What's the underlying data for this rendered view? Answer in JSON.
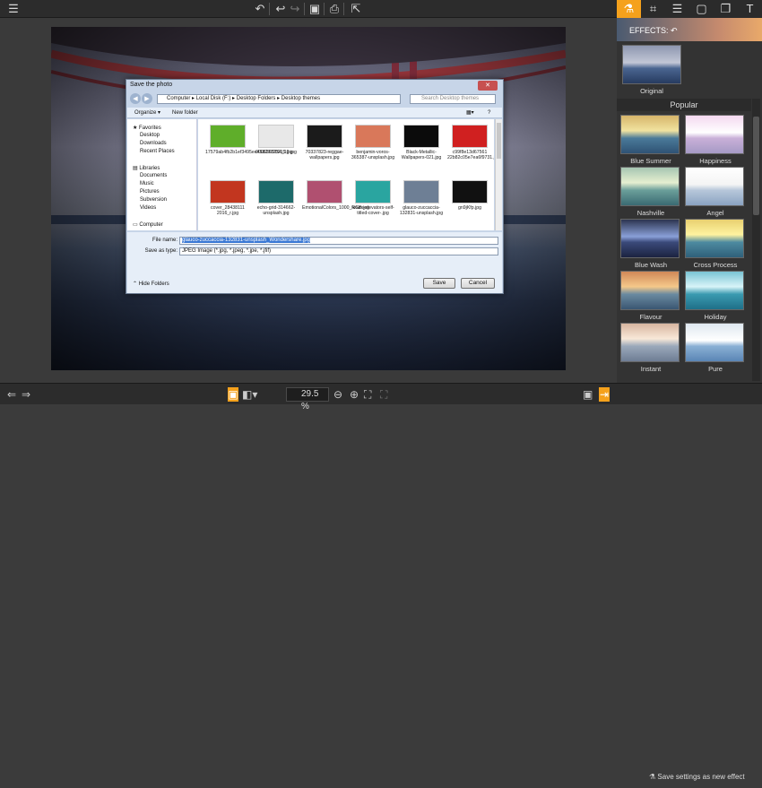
{
  "toolbar": {
    "icons": [
      "menu-icon",
      "undo-icon",
      "redo-back-icon",
      "redo-icon",
      "save-icon",
      "print-icon",
      "share-icon"
    ]
  },
  "panel": {
    "tabs": [
      "effects-tab",
      "crop-tab",
      "adjust-tab",
      "frames-tab",
      "layers-tab",
      "text-tab"
    ],
    "effects_label": "EFFECTS:",
    "original_label": "Original",
    "section_title": "Popular",
    "effects": [
      "Blue Summer",
      "Happiness",
      "Nashville",
      "Angel",
      "Blue Wash",
      "Cross Process",
      "Flavour",
      "Holiday",
      "Instant",
      "Pure"
    ],
    "save_settings": "Save settings as new effect",
    "accent": "#f5a11c"
  },
  "bottom": {
    "zoom": "29.5 %"
  },
  "dialog": {
    "title": "Save the photo",
    "address": [
      "Computer",
      "Local Disk (F:)",
      "Desktop Folders",
      "Desktop themes"
    ],
    "search_placeholder": "Search Desktop themes",
    "organize": "Organize ▾",
    "new_folder": "New folder",
    "nav": {
      "favorites": "Favorites",
      "fav_items": [
        "Desktop",
        "Downloads",
        "Recent Places"
      ],
      "libraries": "Libraries",
      "lib_items": [
        "Documents",
        "Music",
        "Pictures",
        "Subversion",
        "Videos"
      ],
      "computer": "Computer"
    },
    "files": [
      {
        "name": "17579ab4fb2b1ef3495ee45829720215.jpg",
        "color": "#5fae2a"
      },
      {
        "name": "0006268254_10.jpg",
        "color": "#e8e8e8"
      },
      {
        "name": "70337823-reggae-wallpapers.jpg",
        "color": "#1b1b1b"
      },
      {
        "name": "benjamin-voros-365387-unsplash.jpg",
        "color": "#d9785a"
      },
      {
        "name": "Black-Metallic-Wallpapers-021.jpg",
        "color": "#0b0b0b"
      },
      {
        "name": "c99f8e13d67561 22b82c05e7ea6f9731.jpg",
        "color": "#d02020"
      },
      {
        "name": "cover_28438111 2016_r.jpg",
        "color": "#c2361f"
      },
      {
        "name": "echo-grid-314662-unsplash.jpg",
        "color": "#1d6a6a"
      },
      {
        "name": "EmotionalColors_1000_RGB.jpg",
        "color": "#b05070"
      },
      {
        "name": "future-elevators-self-titled-cover-.jpg",
        "color": "#2aa5a0"
      },
      {
        "name": "glauco-zuccaccia-132831-unsplash.jpg",
        "color": "#6e7f95"
      },
      {
        "name": "gn9jKfp.jpg",
        "color": "#111111"
      }
    ],
    "file_name_label": "File name:",
    "file_name_value": "glauco-zuccaccia-132831-unsplash_Wondershare.jpg",
    "save_type_label": "Save as type:",
    "save_type_value": "JPEG Image (*.jpg, *.jpeg, *.jpe, *.jfif)",
    "hide_folders": "Hide Folders",
    "save": "Save",
    "cancel": "Cancel"
  }
}
